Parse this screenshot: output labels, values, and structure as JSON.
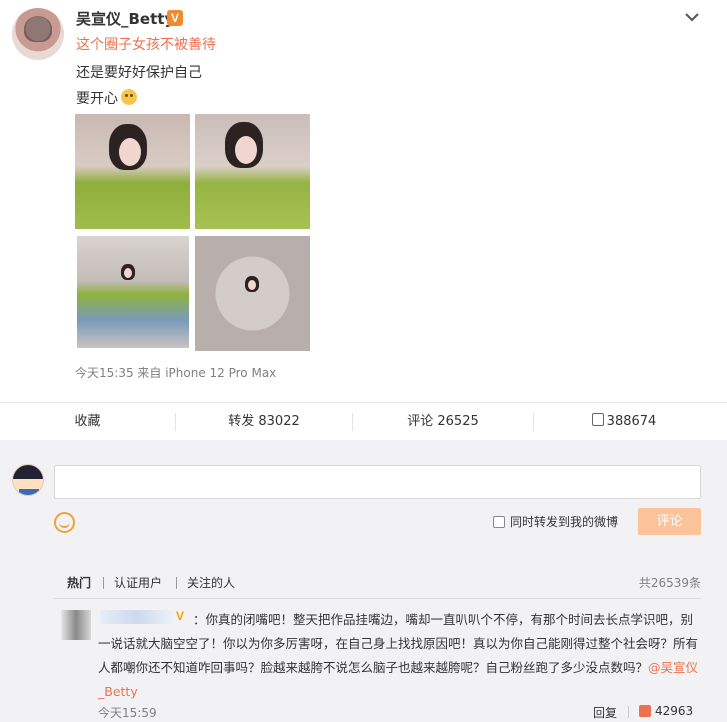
{
  "post": {
    "author": "吴宣仪_Betty",
    "verified_badge": "V",
    "lines": [
      "这个圈子女孩不被善待",
      "还是要好好保护自己",
      "要开心"
    ],
    "meta": "今天15:35  来自 iPhone 12 Pro Max",
    "colors": {
      "accent": "#eb7350",
      "verified": "#f08a2e"
    }
  },
  "actions": {
    "favorite": "收藏",
    "repost": "转发 83022",
    "comment": "评论 26525",
    "likes": "388674"
  },
  "composer": {
    "input_value": "",
    "repost_option": "同时转发到我的微博",
    "submit": "评论"
  },
  "filters": {
    "items": [
      "热门",
      "认证用户",
      "关注的人"
    ],
    "total": "共26539条"
  },
  "comment": {
    "badge": "V",
    "text": "：你真的闭嘴吧！整天把作品挂嘴边，嘴却一直叭叭个不停，有那个时间去长点学识吧，别一说话就大脑空空了！你以为你多厉害呀，在自己身上找找原因吧！真以为你自己能刚得过整个社会呀？所有人都嘲你还不知道咋回事吗？脸越来越胯不说怎么脑子也越来越胯呢？自己粉丝跑了多少没点数吗？",
    "mention": "@吴宣仪_Betty",
    "time": "今天15:59",
    "reply": "回复",
    "likes": "42963"
  },
  "icons": [
    "chevron-down-icon",
    "smile-emoji-icon",
    "thumb-up-icon",
    "emoticon-icon",
    "like-icon"
  ]
}
